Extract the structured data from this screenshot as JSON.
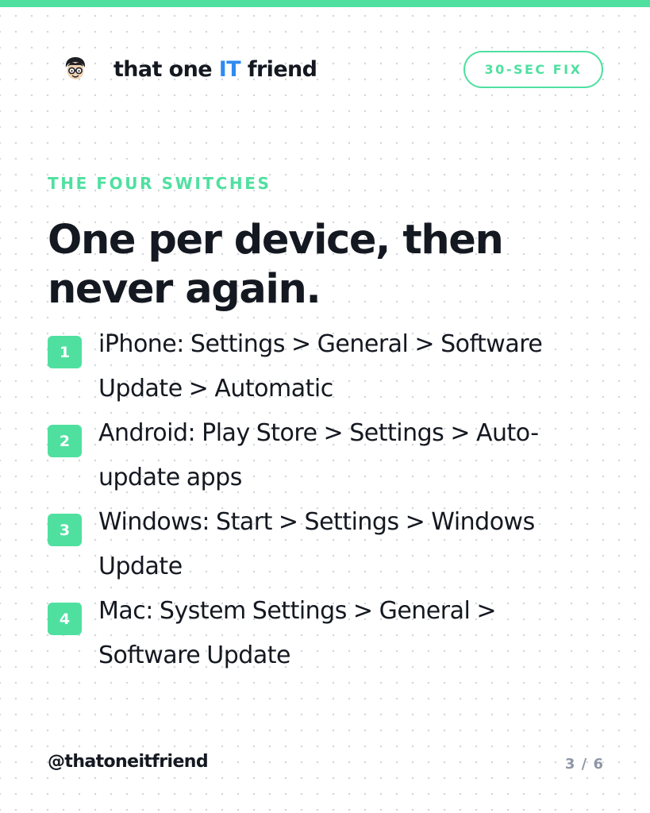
{
  "colors": {
    "accent_green": "#4fe0a0",
    "accent_blue": "#2f8bf0",
    "text_dark": "#141820",
    "text_muted": "#8e97a6"
  },
  "header": {
    "avatar_icon": "nerd-face-with-glasses-icon",
    "brand_prefix": "that one ",
    "brand_accent": "IT",
    "brand_suffix": " friend",
    "badge_label": "30-SEC FIX"
  },
  "main": {
    "eyebrow": "THE FOUR SWITCHES",
    "headline": "One per device, then never again.",
    "steps": [
      {
        "number": "1",
        "text": "iPhone: Settings > General > Software Update > Automatic"
      },
      {
        "number": "2",
        "text": "Android: Play Store > Settings > Auto-update apps"
      },
      {
        "number": "3",
        "text": "Windows: Start > Settings > Windows Update"
      },
      {
        "number": "4",
        "text": "Mac: System Settings > General > Software Update"
      }
    ]
  },
  "footer": {
    "handle": "@thatoneitfriend",
    "page_counter": "3 / 6"
  }
}
